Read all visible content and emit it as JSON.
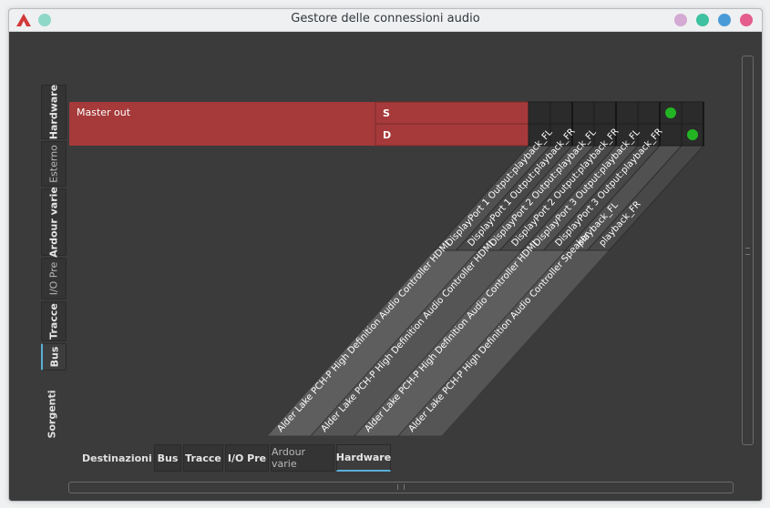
{
  "window": {
    "title": "Gestore delle connessioni audio",
    "accent_color": "#5ab0d8",
    "titlebar_buttons": [
      {
        "name": "keep-above-button",
        "color": "#d4a9d3"
      },
      {
        "name": "minimize-button",
        "color": "#3ec1a0"
      },
      {
        "name": "maximize-button",
        "color": "#4a9ad8"
      },
      {
        "name": "close-button",
        "color": "#e45d8c"
      }
    ]
  },
  "sources": {
    "label": "Sorgenti",
    "tabs": [
      {
        "id": "hardware",
        "label": "Hardware",
        "style": "bold"
      },
      {
        "id": "esterno",
        "label": "Esterno",
        "style": "light"
      },
      {
        "id": "ardour-varie",
        "label": "Ardour varie",
        "style": "bold"
      },
      {
        "id": "io-pre",
        "label": "I/O Pre",
        "style": "light"
      },
      {
        "id": "tracce",
        "label": "Tracce",
        "style": "bold"
      },
      {
        "id": "bus",
        "label": "Bus",
        "style": "bold",
        "active": true
      }
    ]
  },
  "destinations": {
    "label": "Destinazioni",
    "tabs": [
      {
        "id": "bus",
        "label": "Bus",
        "style": "bold"
      },
      {
        "id": "tracce",
        "label": "Tracce",
        "style": "bold"
      },
      {
        "id": "io-pre",
        "label": "I/O Pre",
        "style": "bold"
      },
      {
        "id": "ardour-varie",
        "label": "Ardour varie",
        "style": "light"
      },
      {
        "id": "hardware",
        "label": "Hardware",
        "style": "bold",
        "active": true
      }
    ]
  },
  "matrix": {
    "source_bundle": "Master out",
    "source_ports": [
      "S",
      "D"
    ],
    "row_color": "#a63a3a",
    "cell_color": "#2b2b2b",
    "connection_color": "#22b422",
    "column_ports": [
      "DisplayPort 1 Output:playback_FL",
      "DisplayPort 1 Output:playback_FR",
      "DisplayPort 2 Output:playback_FL",
      "DisplayPort 2 Output:playback_FR",
      "DisplayPort 3 Output:playback_FL",
      "DisplayPort 3 Output:playback_FR",
      "playback_FL",
      "playback_FR"
    ],
    "column_bundles": [
      "Alder Lake PCH-P High Definition Audio Controller HDMI",
      "Alder Lake PCH-P High Definition Audio Controller HDMI",
      "Alder Lake PCH-P High Definition Audio Controller HDMI",
      "Alder Lake PCH-P High Definition Audio Controller Speaker"
    ],
    "bundle_port_counts": [
      2,
      2,
      2,
      2
    ],
    "connections": [
      [
        0,
        6
      ],
      [
        1,
        7
      ]
    ]
  }
}
